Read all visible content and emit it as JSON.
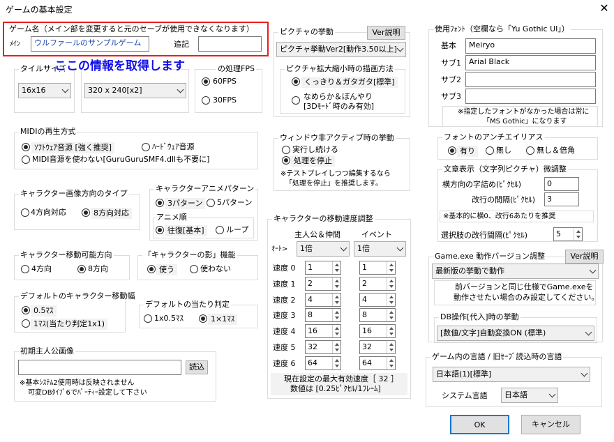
{
  "window": {
    "title": "ゲームの基本設定",
    "close": "✕"
  },
  "game_name": {
    "label": "ゲーム名（メイン部を変更すると元のセーブが使用できなくなります）",
    "main_label": "ﾒｲﾝ",
    "main_value": "ウルファールのサンプルゲーム",
    "sub_label": "追記",
    "sub_value": ""
  },
  "overlay_text": "ここの情報を取得します",
  "tile_size": {
    "label": "タイルサイズ",
    "value": "16x16"
  },
  "resolution": {
    "value": "320 x 240[x2]"
  },
  "fps": {
    "label": "の処理FPS",
    "opt1": "60FPS",
    "opt2": "30FPS"
  },
  "midi": {
    "label": "MIDIの再生方式",
    "opt1": "ｿﾌﾄｳｪｱ音源 [強く推奨]",
    "opt2": "ﾊｰﾄﾞｳｪｱ音源",
    "opt3": "MIDI音源を使わない[GuruGuruSMF4.dllも不要に]"
  },
  "char_dir": {
    "label": "キャラクター画像方向のタイプ",
    "opt1": "4方向対応",
    "opt2": "8方向対応"
  },
  "char_anim": {
    "label": "キャラクターアニメパターン",
    "opt1": "3パターン",
    "opt2": "5パターン",
    "order_label": "アニメ順",
    "order1": "往復[基本]",
    "order2": "ループ"
  },
  "move_dir": {
    "label": "キャラクター移動可能方向",
    "opt1": "4方向",
    "opt2": "8方向"
  },
  "shadow": {
    "label": "「キャラクターの影」機能",
    "opt1": "使う",
    "opt2": "使わない"
  },
  "move_width": {
    "label": "デフォルトのキャラクター移動幅",
    "opt1": "0.5ﾏｽ",
    "opt2": "1ﾏｽ(当たり判定1x1)"
  },
  "hit": {
    "label": "デフォルトの当たり判定",
    "opt1": "1x0.5ﾏｽ",
    "opt2": "1×1ﾏｽ"
  },
  "hero": {
    "label": "初期主人公画像",
    "value": "",
    "read": "読込",
    "note1": "※基本ｼｽﾃﾑ2使用時は反映されません",
    "note2": "可変DBﾀｲﾌﾟ6でﾊﾟｰﾃｨｰ設定して下さい"
  },
  "picture": {
    "label": "ピクチャの挙動",
    "ver_btn": "Ver説明",
    "value": "ピクチャ挙動Ver2[動作3.50以上]",
    "scale_label": "ピクチャ拡大縮小時の描画方法",
    "opt1": "くっきり＆ガタガタ[標準]",
    "opt2a": "なめらか＆ぼんやり",
    "opt2b": "[3Dﾓｰﾄﾞ時のみ有効]"
  },
  "inactive": {
    "label": "ウィンドウ非アクティブ時の挙動",
    "opt1": "実行し続ける",
    "opt2": "処理を停止",
    "note1": "※テストプレイしつつ編集するなら",
    "note2": "「処理を停止」を推奨します。"
  },
  "speed": {
    "label": "キャラクターの移動速度調整",
    "col1": "主人公＆仲間",
    "col2": "イベント",
    "auto": "ｵｰﾄ>",
    "auto1": "1倍",
    "auto2": "1倍",
    "rows": [
      {
        "label": "速度 0",
        "hero": "1",
        "event": "1"
      },
      {
        "label": "速度 1",
        "hero": "2",
        "event": "2"
      },
      {
        "label": "速度 2",
        "hero": "4",
        "event": "4"
      },
      {
        "label": "速度 3",
        "hero": "8",
        "event": "8"
      },
      {
        "label": "速度 4",
        "hero": "16",
        "event": "16"
      },
      {
        "label": "速度 5",
        "hero": "32",
        "event": "32"
      },
      {
        "label": "速度 6",
        "hero": "64",
        "event": "64"
      }
    ],
    "note1": "現在設定の最大有効速度［ 32 ］",
    "note2": "数値は [0.25ﾋﾟｸｾﾙ/1ﾌﾚｰﾑ]"
  },
  "font": {
    "label": "使用ﾌｫﾝﾄ（空欄なら「Yu Gothic UI」）",
    "base_label": "基本",
    "base": "Meiryo",
    "sub1_label": "サブ1",
    "sub1": "Arial Black",
    "sub2_label": "サブ2",
    "sub2": "",
    "sub3_label": "サブ3",
    "sub3": "",
    "note1": "※指定したフォントがなかった場合は常に",
    "note2": "「MS Gothic」になります"
  },
  "antialias": {
    "label": "フォントのアンチエイリアス",
    "opt1": "有り",
    "opt2": "無し",
    "opt3": "無し＆倍角"
  },
  "text_adjust": {
    "label": "文章表示（文字列ピクチャ）微調整",
    "h_label": "横方向の字詰め(ﾋﾟｸｾﾙ)",
    "h_value": "0",
    "line_label": "改行の間隔(ﾋﾟｸｾﾙ)",
    "line_value": "3",
    "note": "※基本的に横0、改行6あたりを推奨",
    "choice_label": "選択肢の改行間隔(ﾋﾟｸｾﾙ)",
    "choice_value": "5"
  },
  "game_exe": {
    "label": "Game.exe 動作バージョン調整",
    "ver_btn": "Ver説明",
    "value": "最新版の挙動で動作",
    "note1": "前バージョンと同じ仕様でGame.exeを",
    "note2": "動作させたい場合のみ設定してください。"
  },
  "db": {
    "label": "DB操作[代入]時の挙動",
    "value": "[数値/文字]自動変換ON (標準)"
  },
  "language": {
    "label": "ゲーム内の言語 / 旧ｾｰﾌﾞ読込時の言語",
    "value": "日本語(1)[標準]",
    "sys_label": "システム言語",
    "sys_value": "日本語"
  },
  "buttons": {
    "ok": "OK",
    "cancel": "キャンセル"
  }
}
